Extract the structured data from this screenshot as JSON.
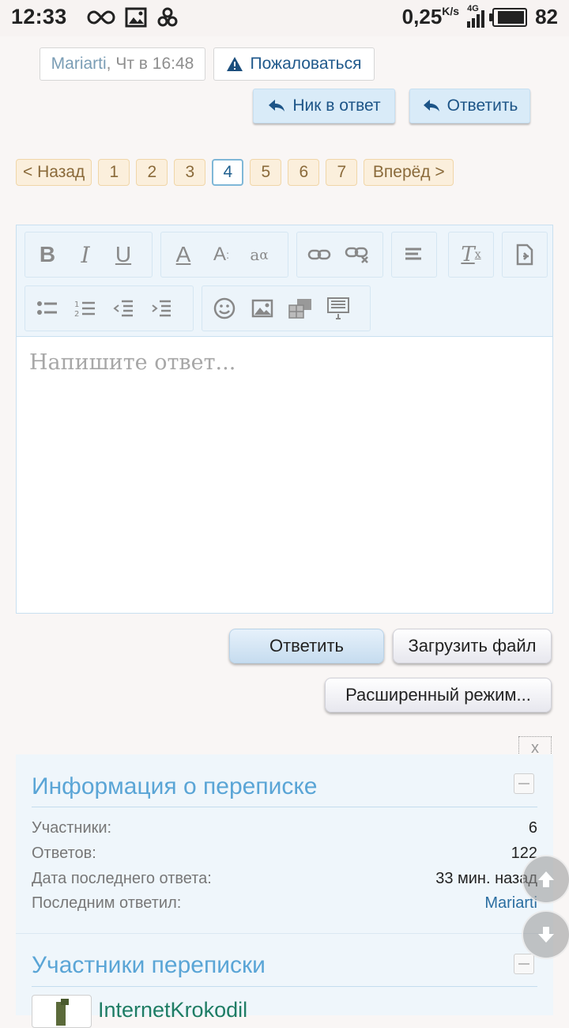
{
  "status_bar": {
    "time": "12:33",
    "speed_value": "0,25",
    "speed_unit": "K/s",
    "network": "4G",
    "battery": "82"
  },
  "post_meta": {
    "author": "Mariarti",
    "time_text": ", Чт в 16:48",
    "report_label": "Пожаловаться"
  },
  "quote_buttons": {
    "nick_reply": "Ник в ответ",
    "reply": "Ответить"
  },
  "pagination": {
    "prev": "< Назад",
    "pages": [
      "1",
      "2",
      "3",
      "4",
      "5",
      "6",
      "7"
    ],
    "current": "4",
    "next": "Вперёд >"
  },
  "editor": {
    "placeholder": "Напишите ответ...",
    "toolbar_icons": [
      "bold-icon",
      "italic-icon",
      "underline-icon",
      "text-color-icon",
      "font-size-icon",
      "font-family-icon",
      "link-icon",
      "unlink-icon",
      "align-icon",
      "remove-format-icon",
      "toggle-source-icon",
      "bullet-list-icon",
      "numbered-list-icon",
      "outdent-icon",
      "indent-icon",
      "smiley-icon",
      "image-icon",
      "media-icon",
      "template-icon"
    ]
  },
  "actions": {
    "reply": "Ответить",
    "upload": "Загрузить файл",
    "advanced": "Расширенный режим..."
  },
  "dismiss": "x",
  "info_panel": {
    "title": "Информация о переписке",
    "rows": [
      {
        "label": "Участники:",
        "value": "6"
      },
      {
        "label": "Ответов:",
        "value": "122"
      },
      {
        "label": "Дата последнего ответа:",
        "value": "33 мин. назад"
      },
      {
        "label": "Последним ответил:",
        "value": "Mariarti"
      }
    ]
  },
  "participants_panel": {
    "title": "Участники переписки",
    "first_member": "InternetKrokodil"
  },
  "colors": {
    "accent": "#5aa5d6",
    "link": "#2b6ea1",
    "page_bg": "#f9f6f5"
  }
}
